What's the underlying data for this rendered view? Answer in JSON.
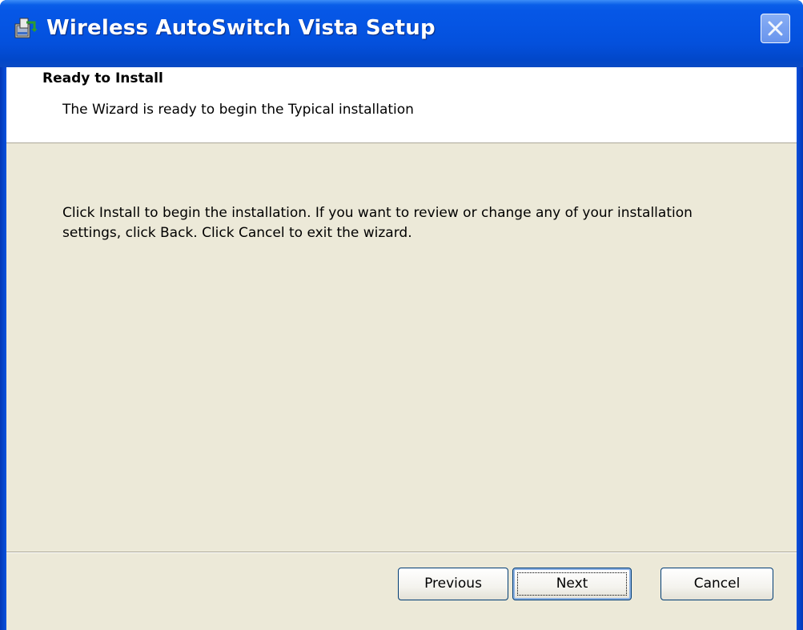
{
  "window": {
    "title": "Wireless AutoSwitch Vista Setup",
    "icon": "setup-installer-icon",
    "close_icon": "close-icon"
  },
  "banner": {
    "title": "Ready to Install",
    "description": "The Wizard is ready to begin the Typical installation"
  },
  "body": {
    "message": "Click Install to begin the installation.  If you want to review or change any of your installation settings, click Back.  Click Cancel to exit the wizard."
  },
  "buttons": {
    "previous_label": "Previous",
    "next_label": "Next",
    "cancel_label": "Cancel"
  },
  "colors": {
    "titlebar": "#0555e4",
    "dialog_background": "#ece9d8",
    "banner_background": "#ffffff"
  }
}
